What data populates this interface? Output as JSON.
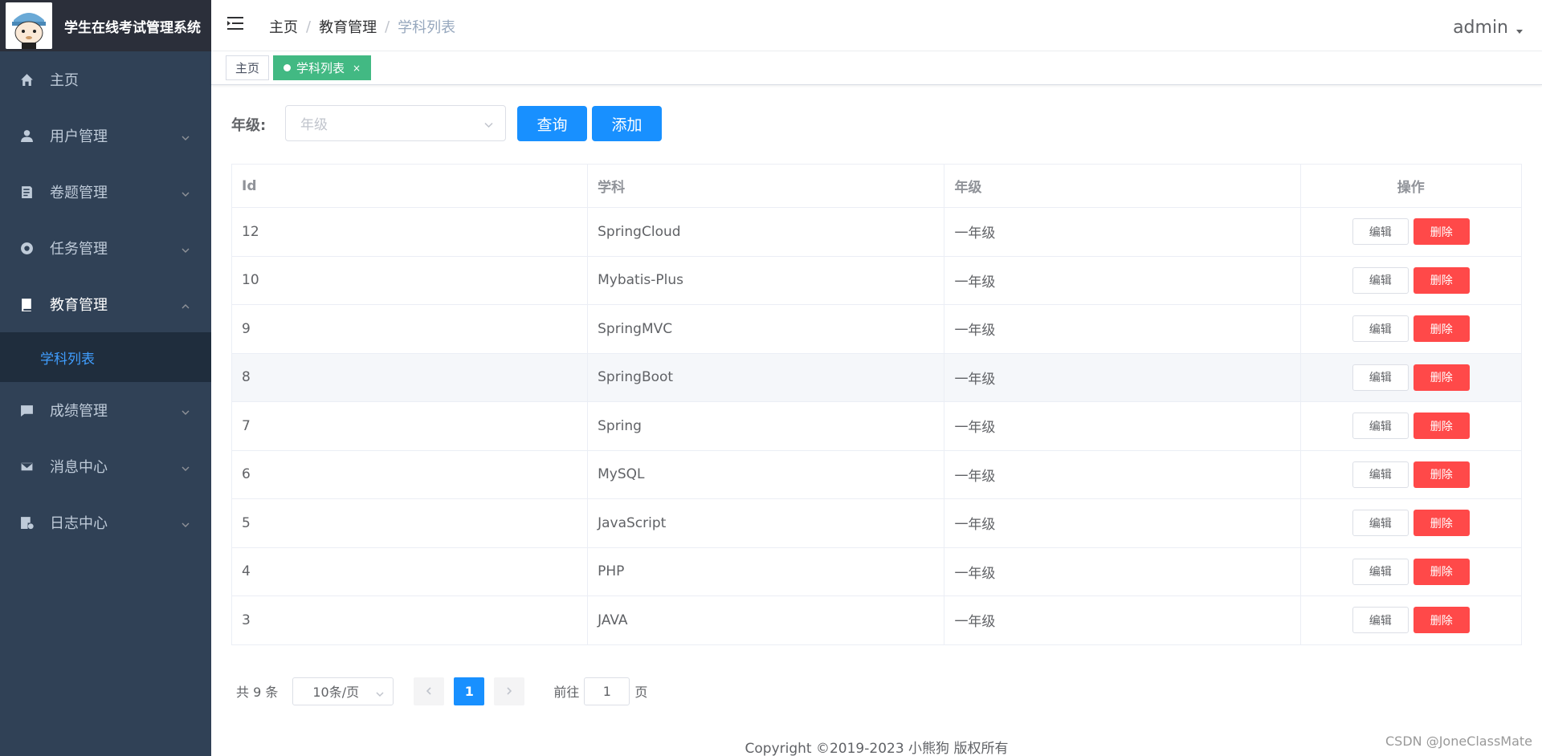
{
  "app": {
    "title": "学生在线考试管理系统"
  },
  "sidebar": {
    "items": [
      {
        "label": "主页",
        "icon": "home-icon"
      },
      {
        "label": "用户管理",
        "icon": "user-icon"
      },
      {
        "label": "卷题管理",
        "icon": "paper-icon"
      },
      {
        "label": "任务管理",
        "icon": "task-icon"
      },
      {
        "label": "教育管理",
        "icon": "book-icon",
        "open": true,
        "children": [
          {
            "label": "学科列表",
            "active": true
          }
        ]
      },
      {
        "label": "成绩管理",
        "icon": "message-icon"
      },
      {
        "label": "消息中心",
        "icon": "mail-icon"
      },
      {
        "label": "日志中心",
        "icon": "log-icon"
      }
    ]
  },
  "header": {
    "breadcrumb": [
      "主页",
      "教育管理",
      "学科列表"
    ],
    "user": "admin"
  },
  "tags": {
    "home": "主页",
    "active": "学科列表",
    "close": "×",
    "active_color": "#42b983"
  },
  "filter": {
    "label": "年级:",
    "placeholder": "年级",
    "query_label": "查询",
    "add_label": "添加"
  },
  "table": {
    "columns": [
      "Id",
      "学科",
      "年级",
      "操作"
    ],
    "edit_label": "编辑",
    "delete_label": "删除",
    "rows": [
      {
        "id": "12",
        "subject": "SpringCloud",
        "grade": "一年级"
      },
      {
        "id": "10",
        "subject": "Mybatis-Plus",
        "grade": "一年级"
      },
      {
        "id": "9",
        "subject": "SpringMVC",
        "grade": "一年级"
      },
      {
        "id": "8",
        "subject": "SpringBoot",
        "grade": "一年级"
      },
      {
        "id": "7",
        "subject": "Spring",
        "grade": "一年级"
      },
      {
        "id": "6",
        "subject": "MySQL",
        "grade": "一年级"
      },
      {
        "id": "5",
        "subject": "JavaScript",
        "grade": "一年级"
      },
      {
        "id": "4",
        "subject": "PHP",
        "grade": "一年级"
      },
      {
        "id": "3",
        "subject": "JAVA",
        "grade": "一年级"
      }
    ]
  },
  "pagination": {
    "total": "共 9 条",
    "page_size": "10条/页",
    "current": "1",
    "goto_prefix": "前往",
    "goto_value": "1",
    "goto_suffix": "页"
  },
  "footer": {
    "copyright": "Copyright ©2019-2023 小熊狗 版权所有"
  },
  "watermark": "CSDN @JoneClassMate",
  "colors": {
    "primary": "#1890ff",
    "danger": "#ff4949",
    "sidebar_bg": "#304156"
  }
}
